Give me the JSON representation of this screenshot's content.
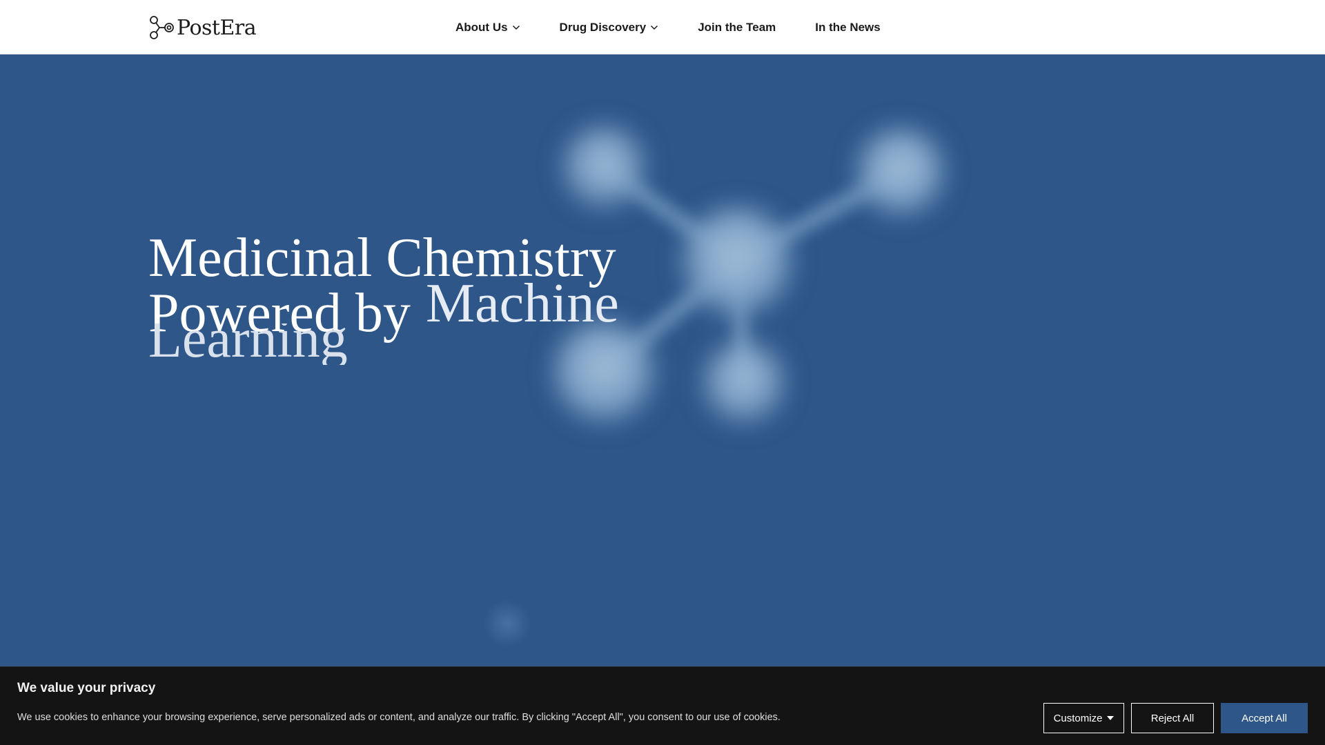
{
  "header": {
    "logo_text": "PostEra",
    "nav": [
      {
        "label": "About Us",
        "has_dropdown": true
      },
      {
        "label": "Drug Discovery",
        "has_dropdown": true
      },
      {
        "label": "Join the Team",
        "has_dropdown": false
      },
      {
        "label": "In the News",
        "has_dropdown": false
      }
    ]
  },
  "hero": {
    "headline_line1": "Medicinal Chemistry",
    "headline_line2_a": "Powered by",
    "headline_line2_b": "Machine",
    "headline_line3": "Learning",
    "background_color": "#2e5689"
  },
  "cookie_banner": {
    "title": "We value your privacy",
    "text": "We use cookies to enhance your browsing experience, serve personalized ads or content, and analyze our traffic. By clicking \"Accept All\", you consent to our use of cookies.",
    "customize_label": "Customize",
    "reject_label": "Reject All",
    "accept_label": "Accept All",
    "accept_color": "#2e5689"
  },
  "icons": [
    "postera-logo-icon",
    "chevron-down-icon",
    "caret-down-icon",
    "molecule-graphic"
  ]
}
